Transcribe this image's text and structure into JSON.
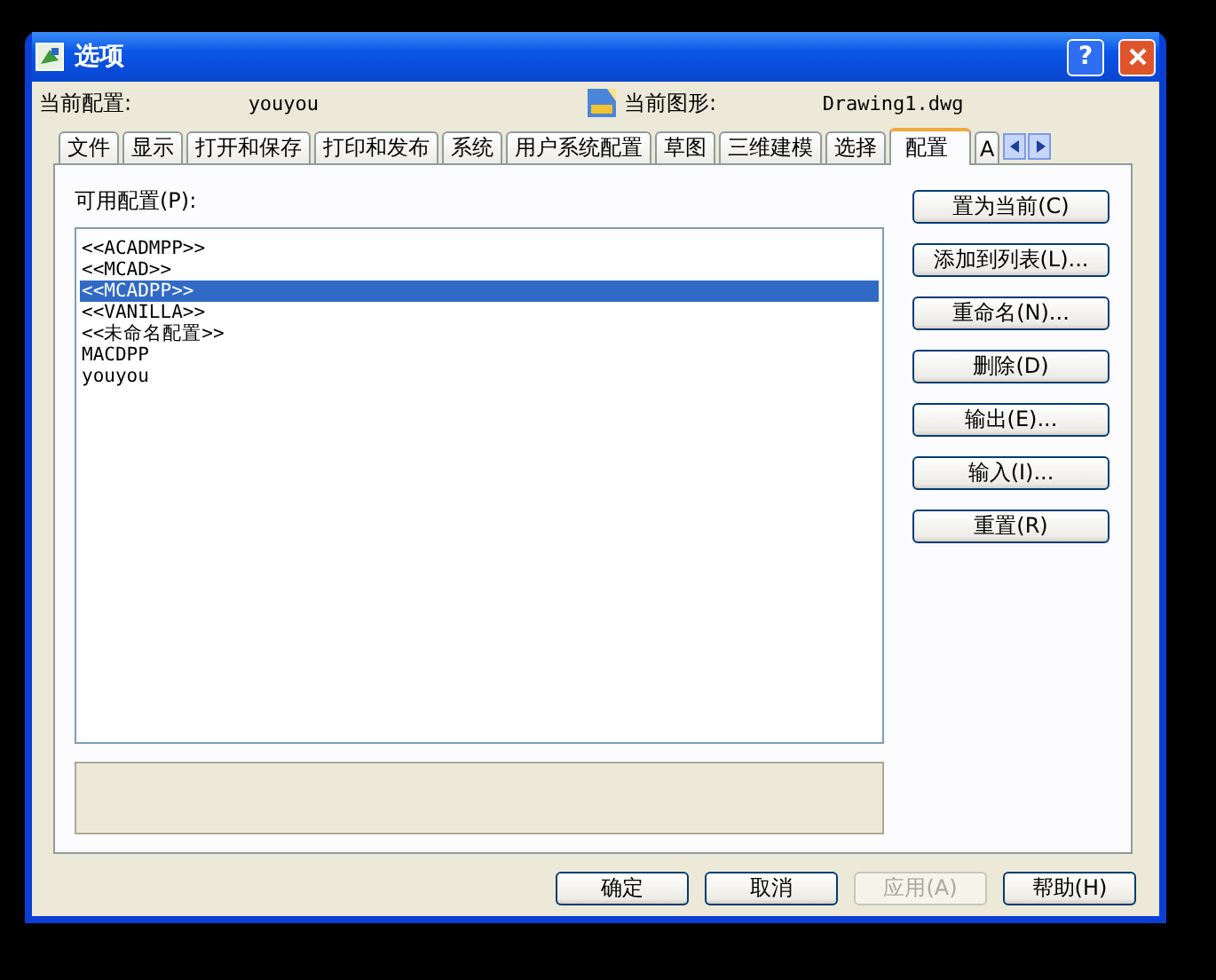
{
  "window": {
    "title": "选项",
    "help_button": "?"
  },
  "info": {
    "profile_label": "当前配置:",
    "profile_value": "youyou",
    "drawing_label": "当前图形:",
    "drawing_value": "Drawing1.dwg"
  },
  "tabs": [
    {
      "label": "文件",
      "selected": false
    },
    {
      "label": "显示",
      "selected": false
    },
    {
      "label": "打开和保存",
      "selected": false
    },
    {
      "label": "打印和发布",
      "selected": false
    },
    {
      "label": "系统",
      "selected": false
    },
    {
      "label": "用户系统配置",
      "selected": false
    },
    {
      "label": "草图",
      "selected": false
    },
    {
      "label": "三维建模",
      "selected": false
    },
    {
      "label": "选择",
      "selected": false
    },
    {
      "label": "配置",
      "selected": true
    },
    {
      "label": "A",
      "selected": false
    }
  ],
  "panel": {
    "label": "可用配置(P):",
    "profiles": [
      {
        "label": "<<ACADMPP>>",
        "selected": false
      },
      {
        "label": "<<MCAD>>",
        "selected": false
      },
      {
        "label": "<<MCADPP>>",
        "selected": true
      },
      {
        "label": "<<VANILLA>>",
        "selected": false
      },
      {
        "label": "<<未命名配置>>",
        "selected": false
      },
      {
        "label": "MACDPP",
        "selected": false
      },
      {
        "label": "youyou",
        "selected": false
      }
    ],
    "buttons": [
      "置为当前(C)",
      "添加到列表(L)...",
      "重命名(N)...",
      "删除(D)",
      "输出(E)...",
      "输入(I)...",
      "重置(R)"
    ]
  },
  "dialog_buttons": [
    {
      "label": "确定",
      "disabled": false
    },
    {
      "label": "取消",
      "disabled": false
    },
    {
      "label": "应用(A)",
      "disabled": true
    },
    {
      "label": "帮助(H)",
      "disabled": false
    }
  ]
}
